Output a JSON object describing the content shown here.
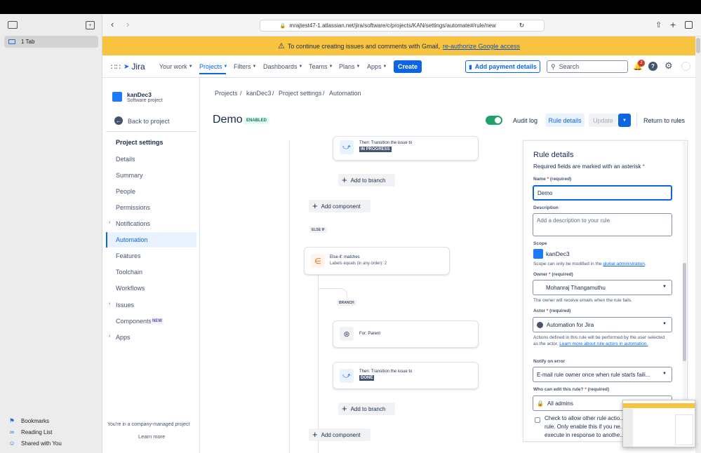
{
  "browser": {
    "tab_label": "1 Tab",
    "url": "mrajtest47-1.atlassian.net/jira/software/c/projects/KAN/settings/automate#/rule/new",
    "bookmarks": [
      {
        "label": "Bookmarks",
        "icon": "bookmark-icon"
      },
      {
        "label": "Reading List",
        "icon": "glasses-icon"
      },
      {
        "label": "Shared with You",
        "icon": "people-icon"
      }
    ]
  },
  "banner": {
    "text": "To continue creating issues and comments with Gmail,",
    "link": "re-authorize Google access"
  },
  "topnav": {
    "logo": "Jira",
    "items": [
      "Your work",
      "Projects",
      "Filters",
      "Dashboards",
      "Teams",
      "Plans",
      "Apps"
    ],
    "create_label": "Create",
    "payment_label": "Add payment details",
    "search_placeholder": "Search",
    "notification_count": "2"
  },
  "project": {
    "name": "kanDec3",
    "type": "Software project",
    "back_label": "Back to project",
    "section_title": "Project settings",
    "items": [
      "Details",
      "Summary",
      "People",
      "Permissions",
      "Notifications",
      "Automation",
      "Features",
      "Toolchain",
      "Workflows",
      "Issues",
      "Components",
      "Apps"
    ],
    "components_badge": "NEW",
    "footer_text": "You're in a company-managed project",
    "learn_more": "Learn more"
  },
  "breadcrumbs": [
    "Projects",
    "kanDec3",
    "Project settings",
    "Automation"
  ],
  "rule": {
    "title": "Demo",
    "status": "ENABLED",
    "audit_log": "Audit log",
    "rule_details_btn": "Rule details",
    "update_btn": "Update",
    "return_btn": "Return to rules"
  },
  "canvas": {
    "then_prefix": "Then: Transition the issue to",
    "status_in_progress": "IN PROGRESS",
    "status_done": "DONE",
    "add_to_branch": "Add to branch",
    "add_component": "Add component",
    "else_if_tag": "ELSE IF",
    "else_if_title": "Else-if: matches",
    "else_if_detail": "Labels equals (in any order): 2",
    "branch_tag": "BRANCH",
    "for_parent": "For: Parent"
  },
  "details": {
    "heading": "Rule details",
    "required_note": "Required fields are marked with an asterisk",
    "name_label": "Name",
    "name_value": "Demo",
    "required_text": "(required)",
    "description_label": "Description",
    "description_placeholder": "Add a description to your rule",
    "scope_label": "Scope",
    "scope_value": "kanDec3",
    "scope_help": "Scope can only be modified in the",
    "scope_help_link": "global administration",
    "owner_label": "Owner",
    "owner_value": "Mohanraj Thangamuthu",
    "owner_help": "The owner will receive emails when the rule fails.",
    "actor_label": "Actor",
    "actor_value": "Automation for Jira",
    "actor_help": "Actions defined in this rule will be performed by the user selected as the actor.",
    "actor_help_link": "Learn more about rule actors in automation.",
    "notify_label": "Notify on error",
    "notify_value": "E-mail rule owner once when rule starts faili...",
    "edit_label": "Who can edit this rule?",
    "edit_value": "All admins",
    "checkbox_text": "Check to allow other rule actio... rule. Only enable this if you ne... execute in response to anothe..."
  },
  "colors": {
    "brand": "#0c66e4",
    "banner": "#f8c33f",
    "enabled": "#22a06b"
  }
}
